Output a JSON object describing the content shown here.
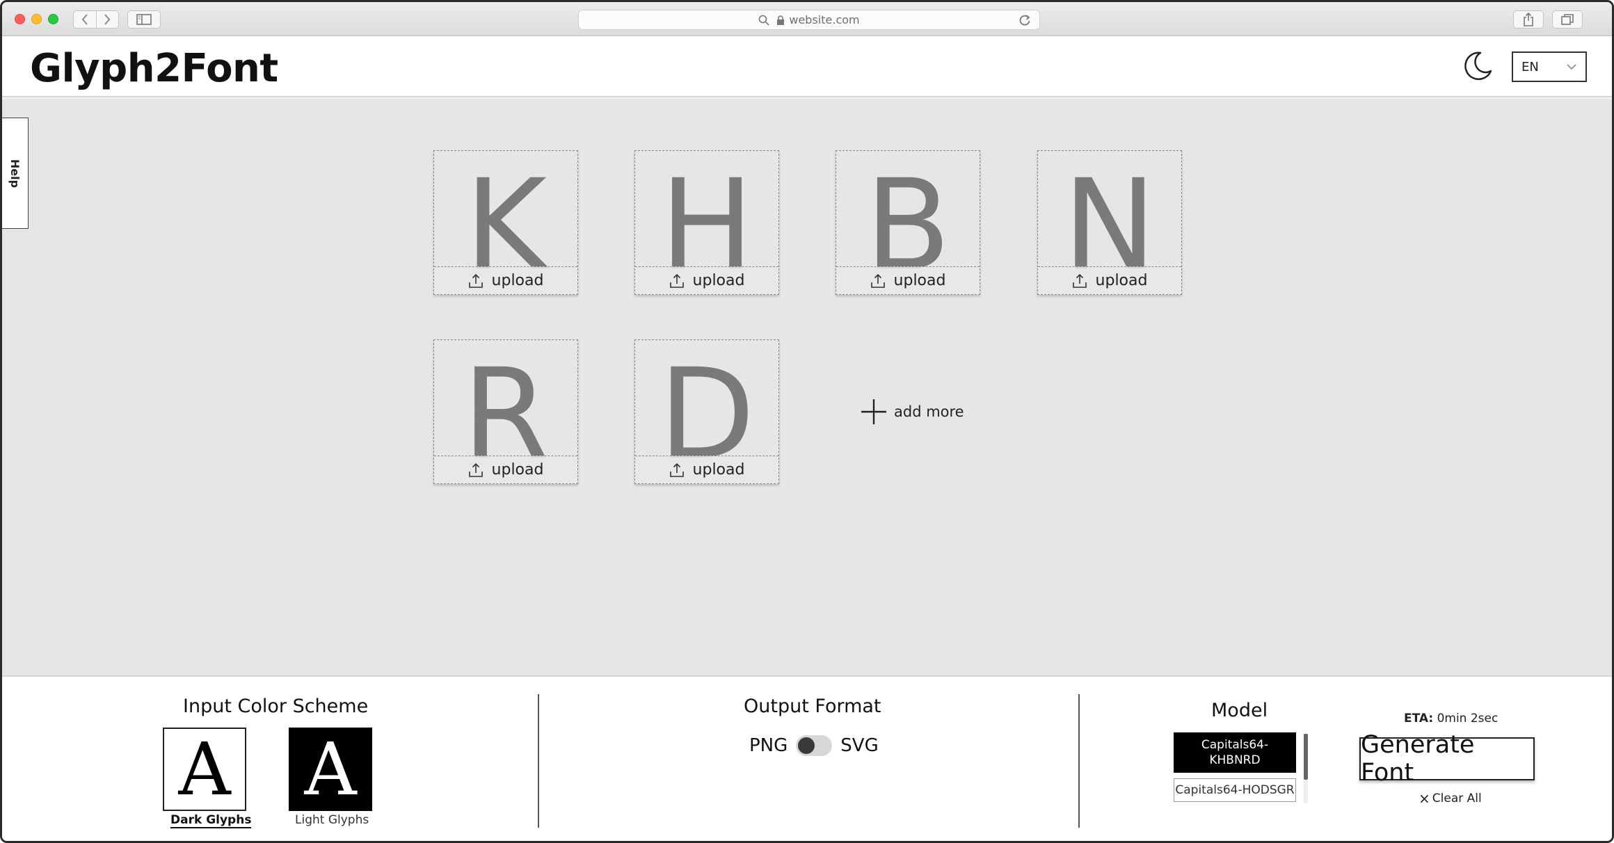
{
  "browser": {
    "url": "website.com"
  },
  "header": {
    "logo": "Glyph2Font",
    "language": "EN",
    "theme_icon": "moon-icon"
  },
  "sidebar": {
    "help_label": "Help"
  },
  "glyph_cards": [
    {
      "glyph": "K",
      "upload_label": "upload"
    },
    {
      "glyph": "H",
      "upload_label": "upload"
    },
    {
      "glyph": "B",
      "upload_label": "upload"
    },
    {
      "glyph": "N",
      "upload_label": "upload"
    },
    {
      "glyph": "R",
      "upload_label": "upload"
    },
    {
      "glyph": "D",
      "upload_label": "upload"
    }
  ],
  "add_more_label": "add more",
  "panel": {
    "color_scheme": {
      "title": "Input Color Scheme",
      "options": [
        {
          "sample": "A",
          "label": "Dark Glyphs",
          "selected": true
        },
        {
          "sample": "A",
          "label": "Light Glyphs",
          "selected": false
        }
      ]
    },
    "output_format": {
      "title": "Output Format",
      "left_label": "PNG",
      "right_label": "SVG",
      "value": "PNG"
    },
    "model": {
      "title": "Model",
      "options": [
        {
          "label": "Capitals64-KHBNRD",
          "selected": true
        },
        {
          "label": "Capitals64-HODSGR",
          "selected": false
        }
      ]
    },
    "eta_label": "ETA:",
    "eta_value": "0min 2sec",
    "generate_label": "Generate Font",
    "clear_label": "Clear All"
  }
}
